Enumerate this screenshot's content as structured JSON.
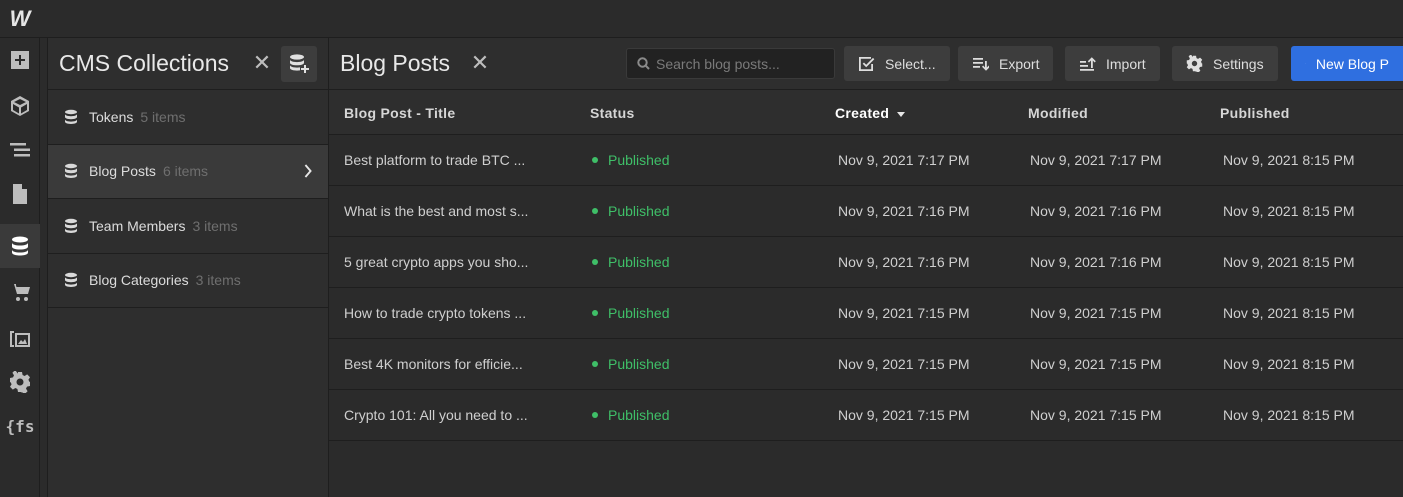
{
  "app": {
    "logo": "W"
  },
  "rail": {
    "items": [
      {
        "icon": "plus-square-icon"
      },
      {
        "icon": "cube-icon"
      },
      {
        "icon": "navigator-icon"
      },
      {
        "icon": "page-icon"
      },
      {
        "icon": "database-icon",
        "active": true
      },
      {
        "icon": "cart-icon"
      },
      {
        "icon": "assets-icon"
      },
      {
        "icon": "gear-icon"
      },
      {
        "icon": "finsweet-icon",
        "text": "{fs"
      }
    ]
  },
  "collections": {
    "title": "CMS Collections",
    "close": "✕",
    "items": [
      {
        "name": "Tokens",
        "count": "5 items"
      },
      {
        "name": "Blog Posts",
        "count": "6 items",
        "active": true
      },
      {
        "name": "Team Members",
        "count": "3 items"
      },
      {
        "name": "Blog Categories",
        "count": "3 items"
      }
    ]
  },
  "main": {
    "title": "Blog Posts",
    "close": "✕",
    "search_placeholder": "Search blog posts...",
    "buttons": {
      "select": "Select...",
      "export": "Export",
      "import": "Import",
      "settings": "Settings",
      "new_item": "New Blog P"
    },
    "columns": [
      "Blog Post - Title",
      "Status",
      "Created",
      "Modified",
      "Published"
    ],
    "rows": [
      {
        "title": "Best platform to trade BTC ...",
        "status": "Published",
        "created": "Nov 9, 2021 7:17 PM",
        "modified": "Nov 9, 2021 7:17 PM",
        "published": "Nov 9, 2021 8:15 PM"
      },
      {
        "title": "What is the best and most s...",
        "status": "Published",
        "created": "Nov 9, 2021 7:16 PM",
        "modified": "Nov 9, 2021 7:16 PM",
        "published": "Nov 9, 2021 8:15 PM"
      },
      {
        "title": "5 great crypto apps you sho...",
        "status": "Published",
        "created": "Nov 9, 2021 7:16 PM",
        "modified": "Nov 9, 2021 7:16 PM",
        "published": "Nov 9, 2021 8:15 PM"
      },
      {
        "title": "How to trade crypto tokens ...",
        "status": "Published",
        "created": "Nov 9, 2021 7:15 PM",
        "modified": "Nov 9, 2021 7:15 PM",
        "published": "Nov 9, 2021 8:15 PM"
      },
      {
        "title": "Best 4K monitors for efficie...",
        "status": "Published",
        "created": "Nov 9, 2021 7:15 PM",
        "modified": "Nov 9, 2021 7:15 PM",
        "published": "Nov 9, 2021 8:15 PM"
      },
      {
        "title": "Crypto 101: All you need to ...",
        "status": "Published",
        "created": "Nov 9, 2021 7:15 PM",
        "modified": "Nov 9, 2021 7:15 PM",
        "published": "Nov 9, 2021 8:15 PM"
      }
    ]
  },
  "colors": {
    "accent": "#2f6fe0",
    "published": "#3fbf68"
  }
}
